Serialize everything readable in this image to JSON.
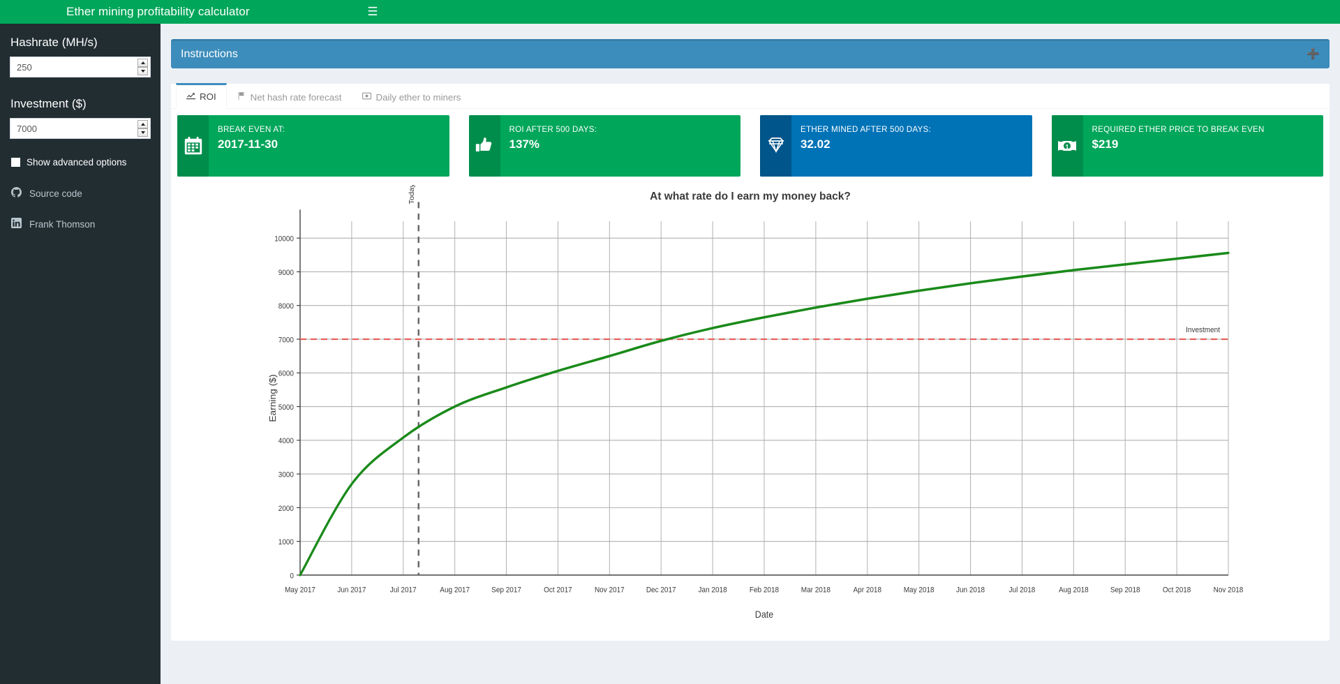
{
  "app": {
    "title": "Ether mining profitability calculator",
    "menu_toggle_icon": "hamburger-icon"
  },
  "sidebar": {
    "hashrate": {
      "label": "Hashrate (MH/s)",
      "value": "250"
    },
    "investment": {
      "label": "Investment ($)",
      "value": "7000"
    },
    "advanced_options_label": "Show advanced options",
    "links": [
      {
        "label": "Source code",
        "icon": "github-icon"
      },
      {
        "label": "Frank Thomson",
        "icon": "linkedin-icon"
      }
    ]
  },
  "instructions": {
    "title": "Instructions",
    "expand_icon": "plus-icon"
  },
  "tabs": [
    {
      "label": "ROI",
      "icon": "line-chart-icon",
      "active": true
    },
    {
      "label": "Net hash rate forecast",
      "icon": "flag-icon",
      "active": false
    },
    {
      "label": "Daily ether to miners",
      "icon": "money-icon",
      "active": false
    }
  ],
  "cards": [
    {
      "sub": "BREAK EVEN AT:",
      "value": "2017-11-30",
      "color": "green",
      "icon": "calendar-icon"
    },
    {
      "sub": "ROI AFTER 500 DAYS:",
      "value": "137%",
      "color": "green",
      "icon": "thumbs-up-icon"
    },
    {
      "sub": "ETHER MINED AFTER 500 DAYS:",
      "value": "32.02",
      "color": "blue",
      "icon": "diamond-icon"
    },
    {
      "sub": "REQUIRED ETHER PRICE TO BREAK EVEN",
      "value": "$219",
      "color": "green",
      "icon": "money-bill-icon"
    }
  ],
  "colors": {
    "brand_green": "#00a65a",
    "brand_green_dark": "#008d4c",
    "brand_blue": "#0073b7",
    "brand_blue_dark": "#00558a",
    "instructions_blue": "#3c8dbc",
    "sidebar_dark": "#222d32",
    "series_green": "#1a8a1a",
    "investment_red": "#e8605d"
  },
  "chart_data": {
    "type": "line",
    "title": "At what rate do I earn my money back?",
    "xlabel": "Date",
    "ylabel": "Earning ($)",
    "ylim": [
      0,
      10500
    ],
    "yticks": [
      0,
      1000,
      2000,
      3000,
      4000,
      5000,
      6000,
      7000,
      8000,
      9000,
      10000
    ],
    "grid": true,
    "legend": "none",
    "x_tick_labels": [
      "May 2017",
      "Jun 2017",
      "Jul 2017",
      "Aug 2017",
      "Sep 2017",
      "Oct 2017",
      "Nov 2017",
      "Dec 2017",
      "Jan 2018",
      "Feb 2018",
      "Mar 2018",
      "Apr 2018",
      "May 2018",
      "Jun 2018",
      "Jul 2018",
      "Aug 2018",
      "Sep 2018",
      "Oct 2018",
      "Nov 2018"
    ],
    "series": [
      {
        "name": "Earning",
        "color": "#1a8a1a",
        "x": [
          "May 2017",
          "Jun 2017",
          "Jul 2017",
          "Aug 2017",
          "Sep 2017",
          "Oct 2017",
          "Nov 2017",
          "Dec 2017",
          "Jan 2018",
          "Feb 2018",
          "Mar 2018",
          "Apr 2018",
          "May 2018",
          "Jun 2018",
          "Jul 2018",
          "Aug 2018",
          "Sep 2018",
          "Oct 2018",
          "Nov 2018"
        ],
        "values": [
          0,
          2700,
          4080,
          5000,
          5570,
          6060,
          6500,
          6950,
          7330,
          7650,
          7940,
          8200,
          8440,
          8660,
          8860,
          9050,
          9220,
          9390,
          9560
        ]
      }
    ],
    "annotations": [
      {
        "name": "Investment",
        "type": "hline",
        "y": 7000,
        "color": "#e8605d",
        "style": "dashed",
        "label": "Investment"
      },
      {
        "name": "Today",
        "type": "vline",
        "x": "Jul 2017",
        "color": "#686868",
        "style": "dashed",
        "label": "Today"
      }
    ]
  }
}
